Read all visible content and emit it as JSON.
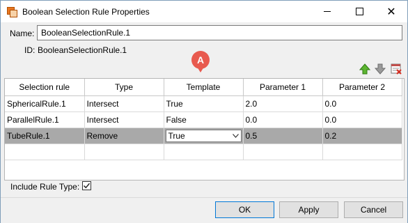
{
  "window": {
    "title": "Boolean Selection Rule Properties",
    "controls": {
      "close": "✕"
    }
  },
  "name": {
    "label": "Name:",
    "value": "BooleanSelectionRule.1"
  },
  "id": {
    "label": "ID:",
    "value": "BooleanSelectionRule.1"
  },
  "callout": {
    "letter": "A",
    "color": "#e85a4f"
  },
  "toolbar": {
    "icons": [
      "move-up-icon",
      "move-down-icon",
      "delete-rule-icon"
    ]
  },
  "table": {
    "columns": [
      "Selection rule",
      "Type",
      "Template",
      "Parameter 1",
      "Parameter 2"
    ],
    "rows": [
      {
        "rule": "SphericalRule.1",
        "type": "Intersect",
        "template": "True",
        "p1": "2.0",
        "p2": "0.0"
      },
      {
        "rule": "ParallelRule.1",
        "type": "Intersect",
        "template": "False",
        "p1": "0.0",
        "p2": "0.0"
      },
      {
        "rule": "TubeRule.1",
        "type": "Remove",
        "template": "True",
        "p1": "0.5",
        "p2": "0.2"
      }
    ],
    "selected_row": 2
  },
  "include_rule_type": {
    "label": "Include Rule Type:",
    "checked": true
  },
  "buttons": {
    "ok": "OK",
    "apply": "Apply",
    "cancel": "Cancel"
  }
}
